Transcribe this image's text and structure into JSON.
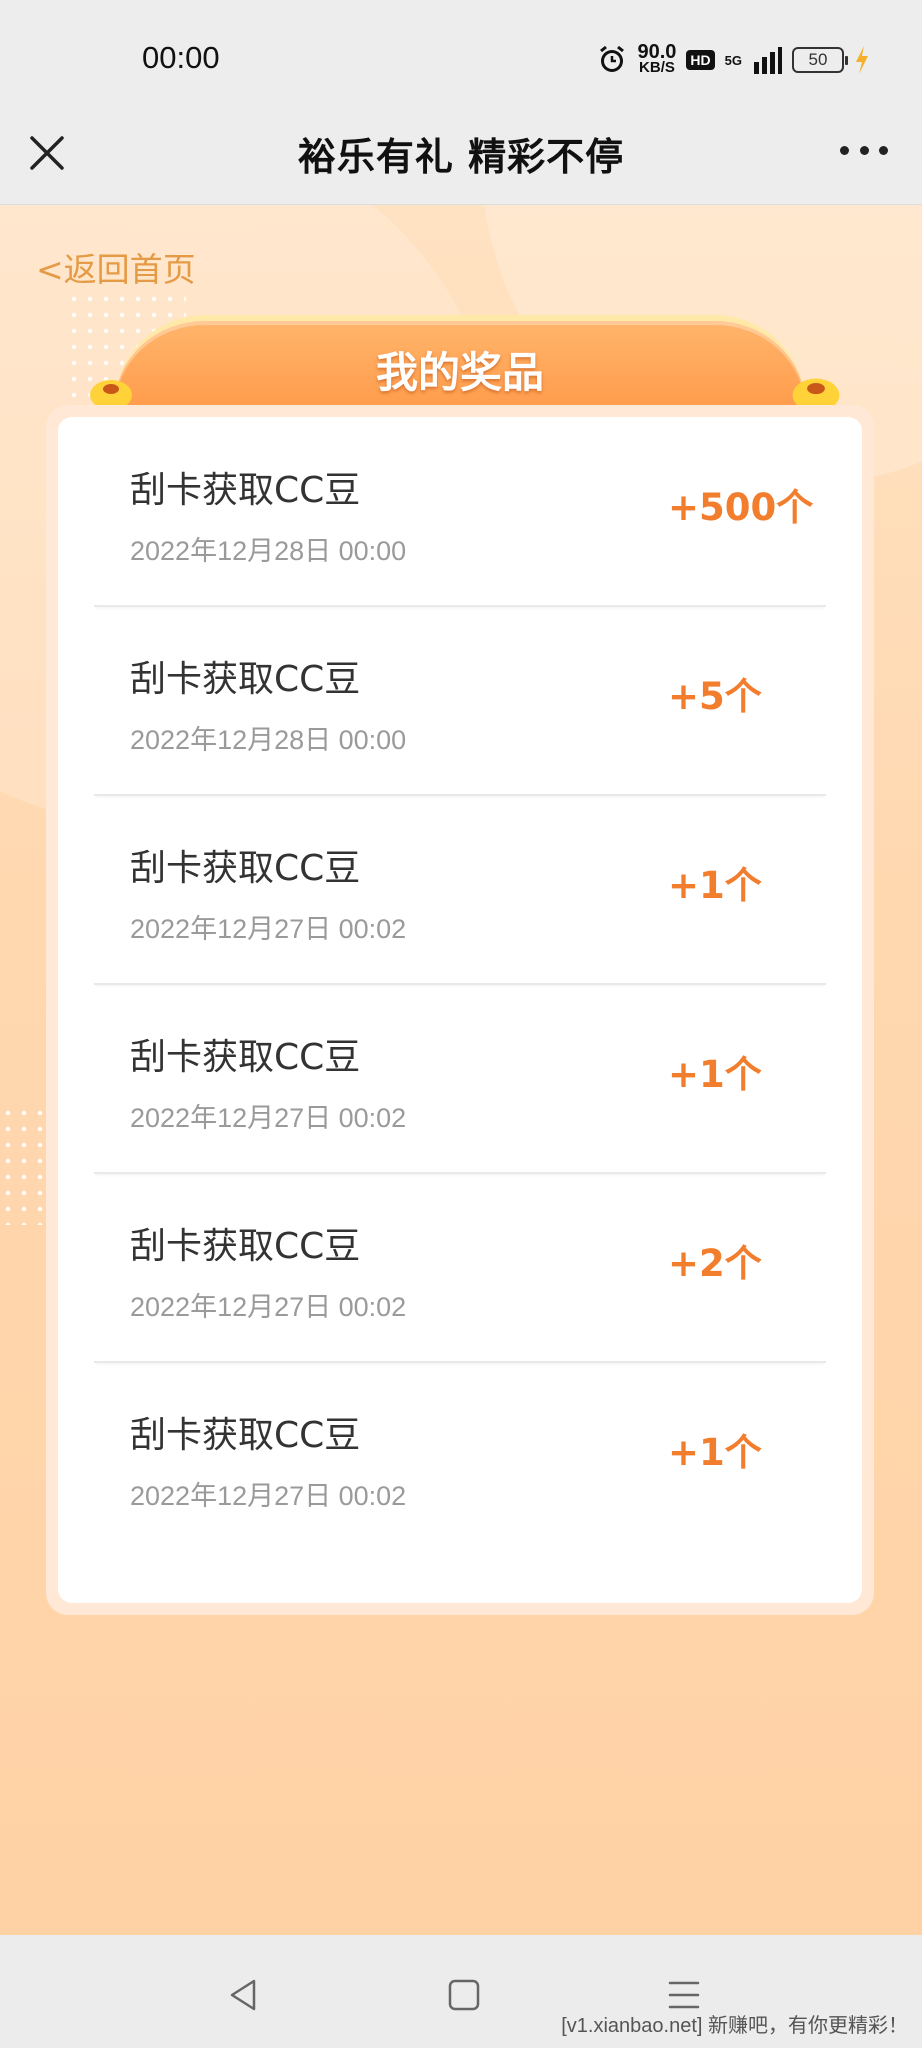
{
  "status_bar": {
    "time": "00:00",
    "speed_value": "90.0",
    "speed_unit": "KB/S",
    "hd_label": "HD",
    "network_label": "5G",
    "battery_level": "50",
    "icons": [
      "alarm-icon",
      "signal-icon",
      "charging-icon"
    ]
  },
  "title_bar": {
    "title": "裕乐有礼 精彩不停",
    "icons": [
      "close-icon",
      "more-icon"
    ]
  },
  "page": {
    "back_label": "<返回首页",
    "panel_title": "我的奖品"
  },
  "prizes": [
    {
      "title": "刮卡获取CC豆",
      "date": "2022年12月28日 00:00",
      "amount": "+500个"
    },
    {
      "title": "刮卡获取CC豆",
      "date": "2022年12月28日 00:00",
      "amount": "+5个"
    },
    {
      "title": "刮卡获取CC豆",
      "date": "2022年12月27日 00:02",
      "amount": "+1个"
    },
    {
      "title": "刮卡获取CC豆",
      "date": "2022年12月27日 00:02",
      "amount": "+1个"
    },
    {
      "title": "刮卡获取CC豆",
      "date": "2022年12月27日 00:02",
      "amount": "+2个"
    },
    {
      "title": "刮卡获取CC豆",
      "date": "2022年12月27日 00:02",
      "amount": "+1个"
    }
  ],
  "nav_bar": {
    "icons": [
      "back-triangle-icon",
      "home-square-icon",
      "menu-lines-icon"
    ]
  },
  "watermark": "[v1.xianbao.net] 新赚吧，有你更精彩！",
  "colors": {
    "accent": "#f27d2c",
    "back_link": "#e59a45",
    "panel_header": "#ff9a47",
    "background": "#ffd6ab"
  }
}
